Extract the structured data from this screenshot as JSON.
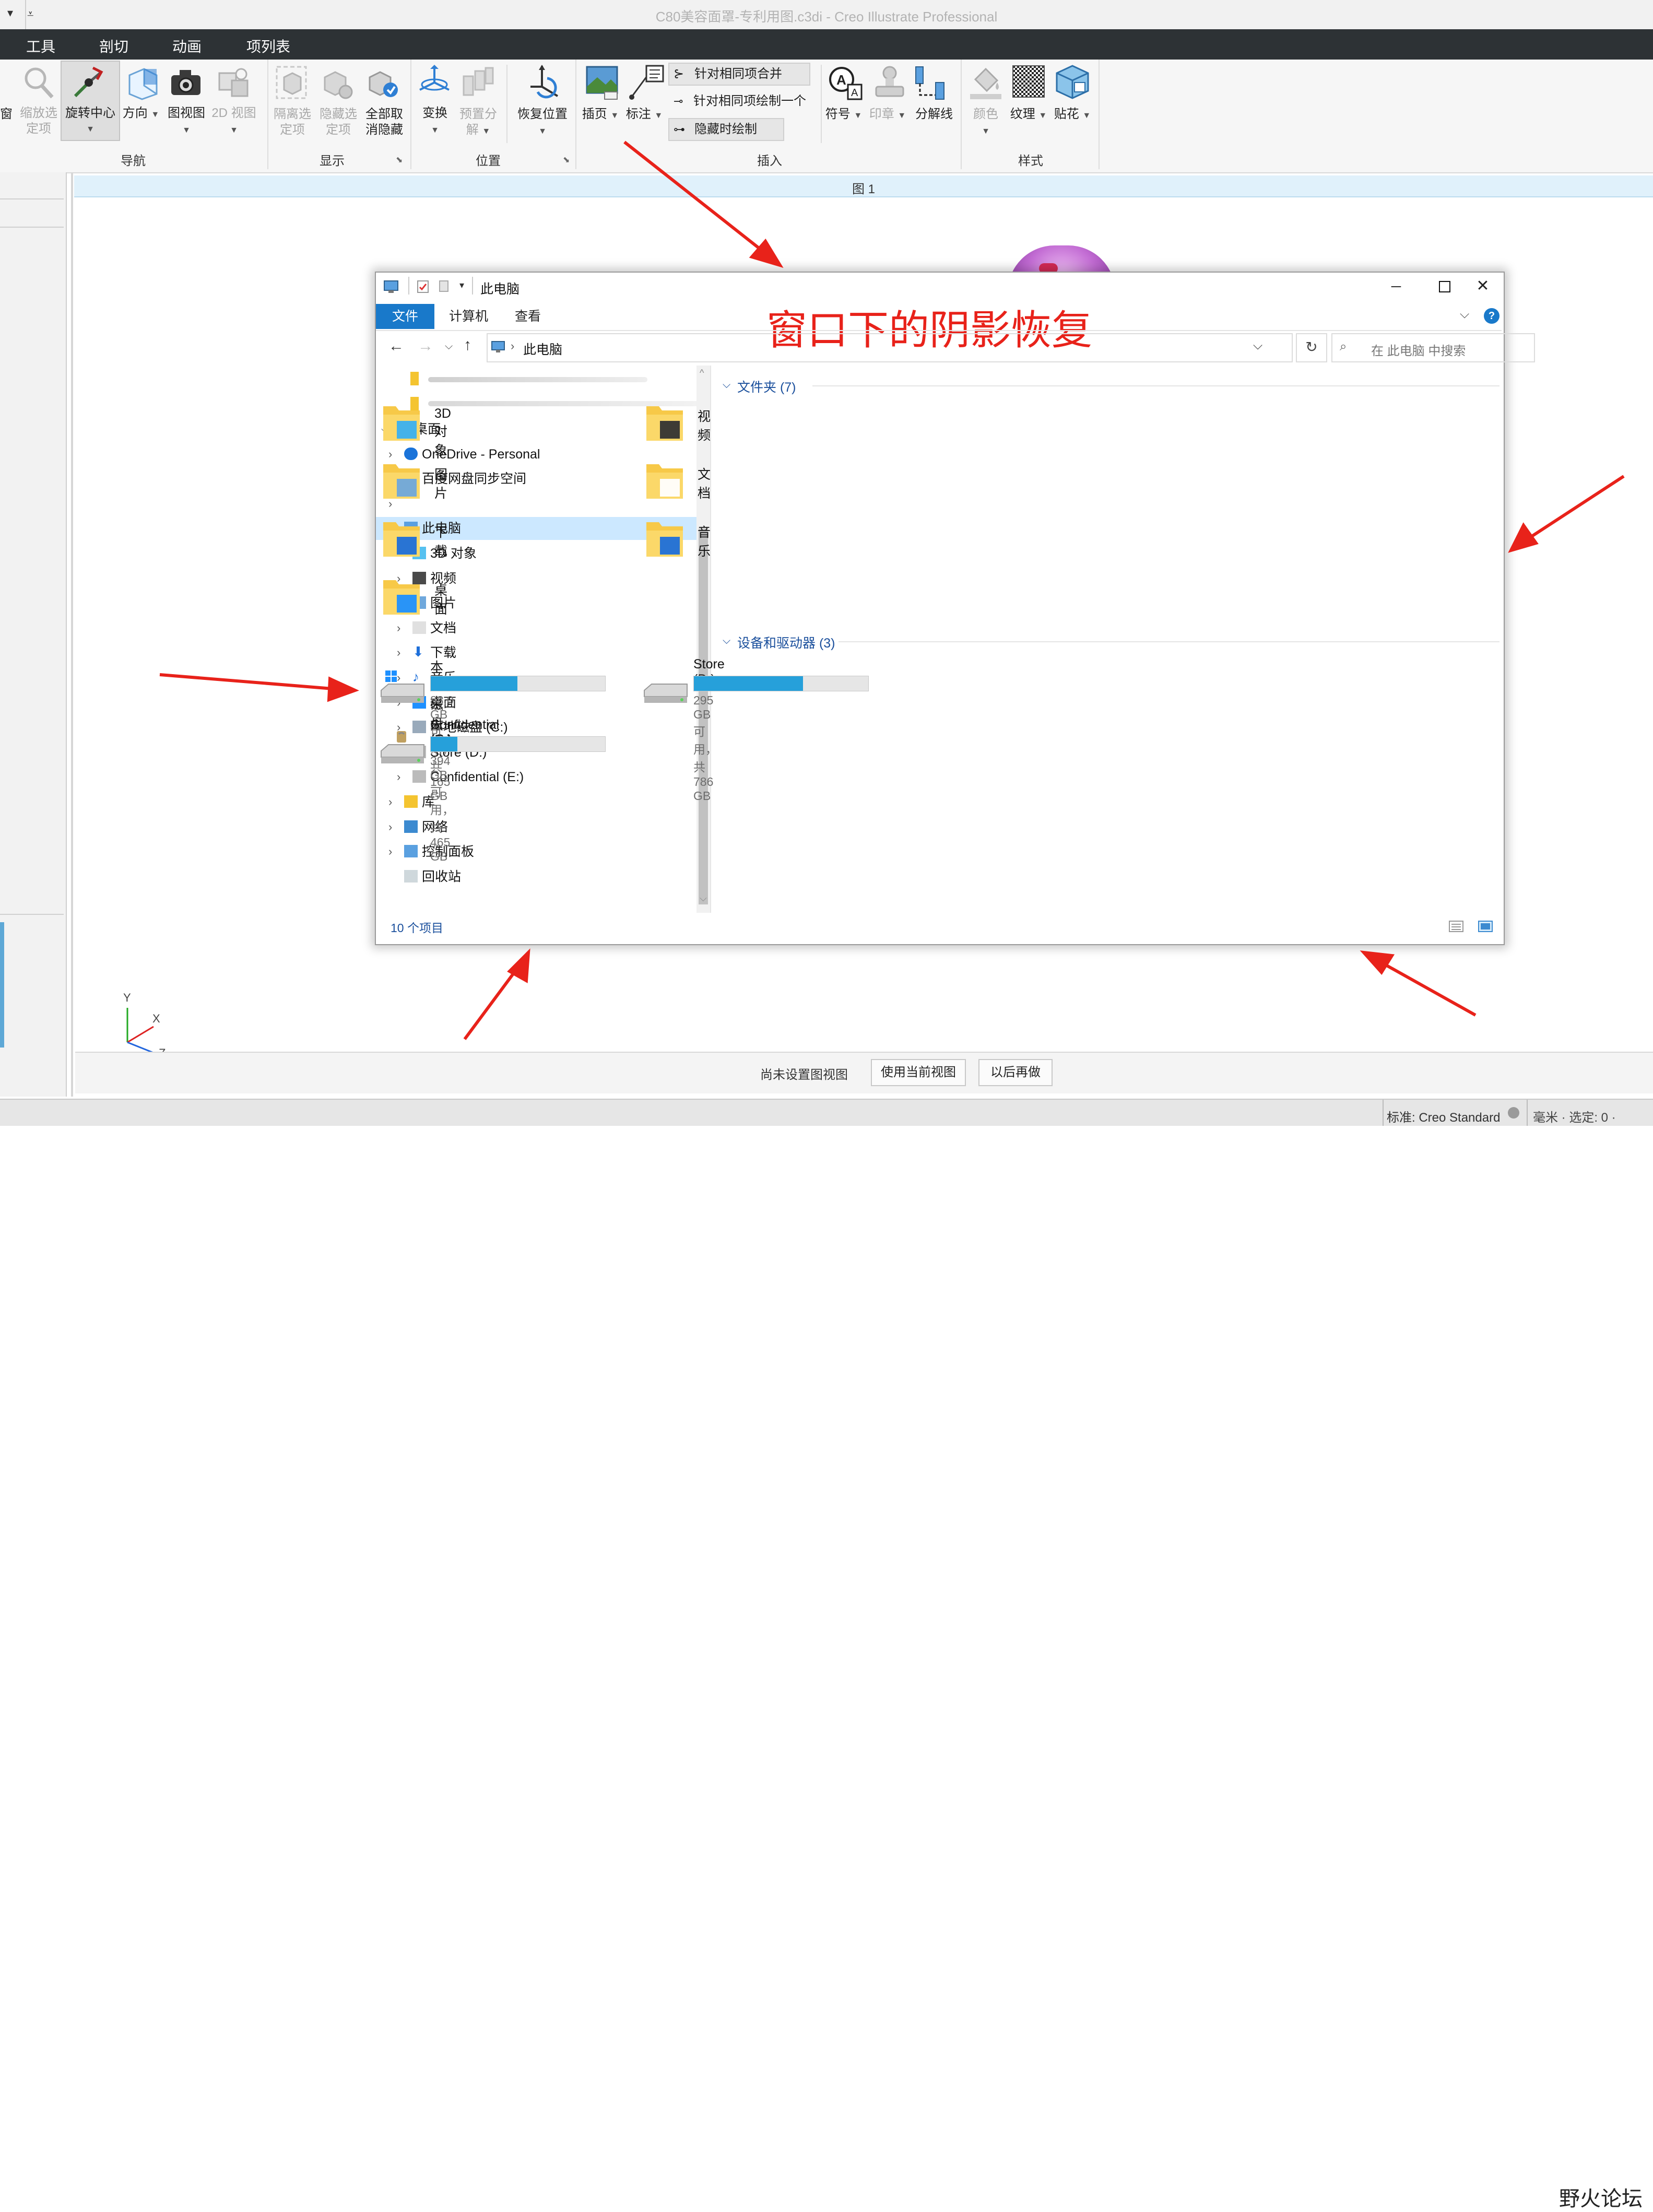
{
  "app": {
    "title": "C80美容面罩-专利用图.c3di - Creo Illustrate Professional"
  },
  "menu": [
    "工具",
    "剖切",
    "动画",
    "项列表"
  ],
  "ribbon": {
    "nav": {
      "window_label": "窗",
      "zoom_label": [
        "缩放选",
        "定项"
      ],
      "rotate_center_label": "旋转中心",
      "direction_label": "方向",
      "view_label": "图视图",
      "view2d_label": "2D 视图",
      "group": "导航"
    },
    "display": {
      "isolate_label": [
        "隔离选",
        "定项"
      ],
      "hide_label": [
        "隐藏选",
        "定项"
      ],
      "unhide_label": [
        "全部取",
        "消隐藏"
      ],
      "group": "显示"
    },
    "position": {
      "transform_label": "变换",
      "preset_label": [
        "预置分",
        "解"
      ],
      "restore_label": "恢复位置",
      "group": "位置"
    },
    "insert": {
      "callout_label": "插页",
      "annotation_label": "标注",
      "merge_label": "针对相同项合并",
      "draw_one_label": "针对相同项绘制一个",
      "hidden_draw_label": "隐藏时绘制",
      "group": "插入"
    },
    "symbol": {
      "symbol_label": "符号",
      "stamp_label": "印章",
      "breakline_label": "分解线"
    },
    "style": {
      "color_label": "颜色",
      "texture_label": "纹理",
      "decal_label": "贴花",
      "group": "样式"
    }
  },
  "figure": {
    "header": "图 1"
  },
  "annotation_text": "窗口下的阴影恢复",
  "axes": {
    "y": "Y",
    "x": "X",
    "z": "Z"
  },
  "bottom_bar": {
    "status": "尚未设置图视图",
    "use_current": "使用当前视图",
    "later": "以后再做"
  },
  "statusbar": {
    "standard": "标准: Creo Standard",
    "unit": "毫米 · 选定: 0 ·",
    "watermark": "野火论坛"
  },
  "explorer": {
    "title": "此电脑",
    "tabs": [
      "文件",
      "计算机",
      "查看"
    ],
    "address": "此电脑",
    "search_placeholder": "在 此电脑 中搜索",
    "tree": [
      {
        "label": "桌面",
        "level": 0,
        "expanded": true
      },
      {
        "label": "OneDrive - Personal",
        "level": 1
      },
      {
        "label": "百度网盘同步空间",
        "level": 1
      },
      {
        "label": "",
        "level": 1
      },
      {
        "label": "此电脑",
        "level": 1,
        "expanded": true,
        "selected": true
      },
      {
        "label": "3D 对象",
        "level": 2
      },
      {
        "label": "视频",
        "level": 2
      },
      {
        "label": "图片",
        "level": 2
      },
      {
        "label": "文档",
        "level": 2
      },
      {
        "label": "下载",
        "level": 2
      },
      {
        "label": "音乐",
        "level": 2
      },
      {
        "label": "桌面",
        "level": 2
      },
      {
        "label": "本地磁盘 (C:)",
        "level": 2
      },
      {
        "label": "Store (D:)",
        "level": 2
      },
      {
        "label": "Confidential (E:)",
        "level": 2
      },
      {
        "label": "库",
        "level": 1
      },
      {
        "label": "网络",
        "level": 1
      },
      {
        "label": "控制面板",
        "level": 1
      },
      {
        "label": "回收站",
        "level": 1
      }
    ],
    "folders_section": "文件夹 (7)",
    "folders": [
      "3D 对象",
      "视频",
      "图片",
      "文档",
      "下载",
      "音乐",
      "桌面"
    ],
    "drives_section": "设备和驱动器 (3)",
    "drives": [
      {
        "name": "本地磁盘 (C:)",
        "info": "83.0 GB 可用，共 165 GB",
        "used_fraction": 0.497
      },
      {
        "name": "Store (D:)",
        "info": "295 GB 可用，共 786 GB",
        "used_fraction": 0.625
      },
      {
        "name": "Confidential (E:)",
        "info": "394 GB 可用，共 465 GB",
        "used_fraction": 0.153
      }
    ],
    "item_count": "10 个项目"
  },
  "colors": {
    "accent": "#0063b1",
    "drive_bar": "#26a0da",
    "arrow": "#e8221a",
    "menubar": "#2d3235"
  }
}
